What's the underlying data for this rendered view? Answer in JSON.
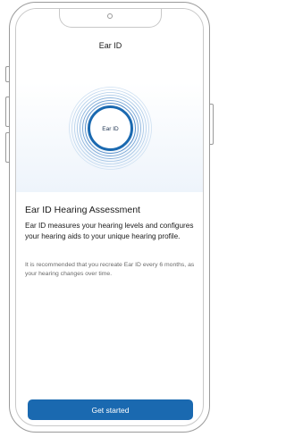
{
  "screen": {
    "title": "Ear ID"
  },
  "graphic": {
    "center_label": "Ear ID",
    "ring_color": "#1a69b0"
  },
  "content": {
    "heading": "Ear ID Hearing Assessment",
    "description": "Ear ID measures your hearing levels and configures your hearing aids to your unique hearing profile.",
    "note": "It is recommended that you recreate Ear ID every 6 months, as your hearing changes over time."
  },
  "actions": {
    "primary_label": "Get started",
    "primary_color": "#1a69b0"
  }
}
